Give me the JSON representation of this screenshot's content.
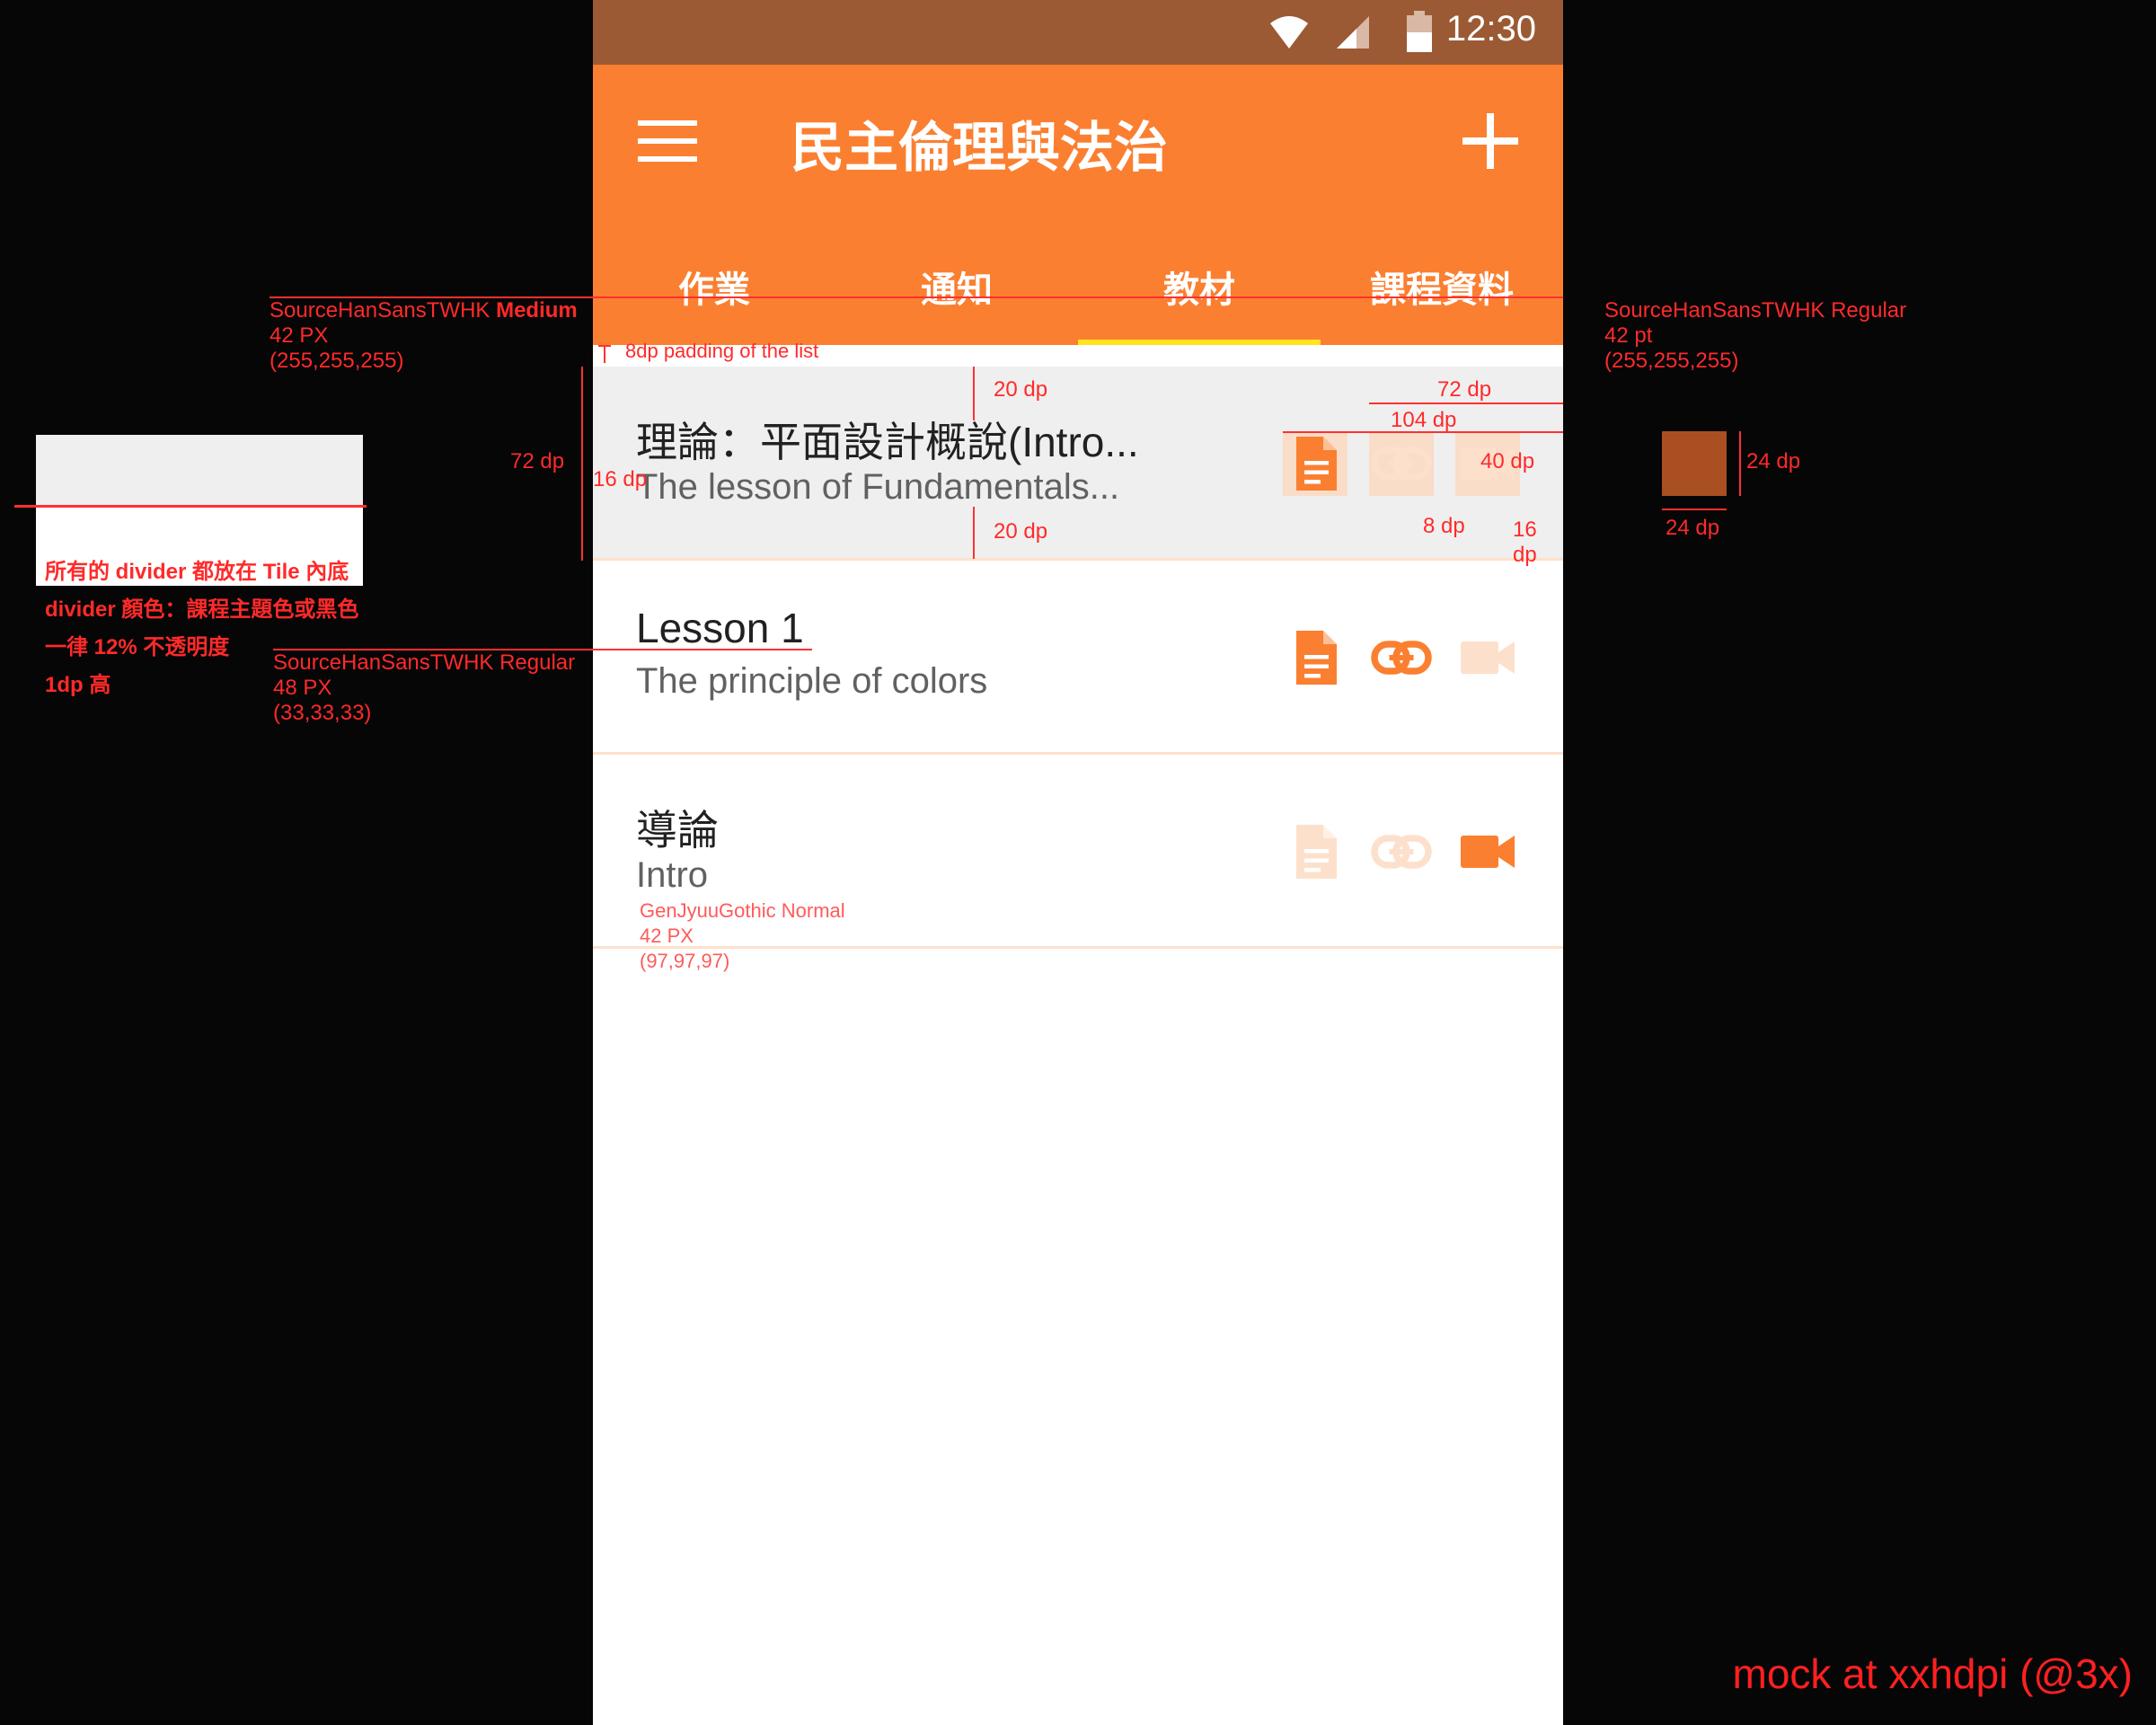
{
  "status_bar": {
    "time": "12:30"
  },
  "app_bar": {
    "title": "民主倫理與法治",
    "tabs": [
      {
        "label": "作業",
        "active": false
      },
      {
        "label": "通知",
        "active": false
      },
      {
        "label": "教材",
        "active": true
      },
      {
        "label": "課程資料",
        "active": false
      }
    ]
  },
  "list": [
    {
      "title": "理論：平面設計概說(Intro...",
      "subtitle": "The lesson of Fundamentals...",
      "icons": [
        "document-icon",
        "link-icon",
        "video-icon"
      ],
      "icon_states": [
        true,
        false,
        false
      ],
      "selected": true
    },
    {
      "title": "Lesson 1",
      "subtitle": "The principle of colors",
      "icons": [
        "document-icon",
        "link-icon",
        "video-icon"
      ],
      "icon_states": [
        true,
        true,
        false
      ],
      "selected": false
    },
    {
      "title": "導論",
      "subtitle": "Intro",
      "icons": [
        "document-icon",
        "link-icon",
        "video-icon"
      ],
      "icon_states": [
        false,
        false,
        true
      ],
      "selected": false
    }
  ],
  "colors": {
    "status_bar": "#9b5a33",
    "app_bar": "#fb7f30",
    "tab_indicator": "#ffe41f",
    "icon_active": "#fb7f30",
    "icon_inactive": "#fde0cc",
    "selected_tile": "#efefef",
    "annotation": "#ff2a2a",
    "swatch": "#a94f22"
  },
  "annotations": {
    "tab_font": {
      "line1_prefix": "SourceHanSansTWHK ",
      "line1_bold": "Medium",
      "line2": "42 PX",
      "line3": "(255,255,255)"
    },
    "title_font": {
      "line1": "SourceHanSansTWHK Regular",
      "line2": "42 pt",
      "line3": "(255,255,255)"
    },
    "list_padding": "8dp padding of the list",
    "tile_height": "72 dp",
    "left_padding": "16 dp",
    "top_padding": "20 dp",
    "bottom_padding": "20 dp",
    "icons_width_72": "72 dp",
    "icons_width_104": "104 dp",
    "icon_box": "40 dp",
    "gap_8": "8 dp",
    "gap_16": "16 dp",
    "swatch_h": "24 dp",
    "swatch_w": "24 dp",
    "divider_notes": [
      "所有的 divider 都放在 Tile 內底",
      "divider 顏色：課程主題色或黑色",
      "一律 12% 不透明度",
      "1dp 高"
    ],
    "primary_font": {
      "line1": "SourceHanSansTWHK Regular",
      "line2": "48 PX",
      "line3": "(33,33,33)"
    },
    "secondary_font": {
      "line1": "GenJyuuGothic Normal",
      "line2": "42 PX",
      "line3": "(97,97,97)"
    },
    "footer": "mock at xxhdpi (@3x)"
  }
}
